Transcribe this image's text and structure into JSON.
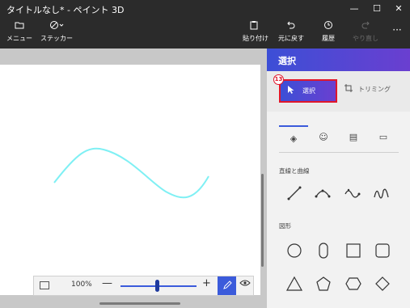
{
  "window": {
    "title": "タイトルなし* - ペイント 3D",
    "minimize": "—",
    "maximize": "☐",
    "close": "✕"
  },
  "toolbar": {
    "menu": {
      "label": "メニュー",
      "icon": "folder-icon"
    },
    "stickers": {
      "label": "ステッカー",
      "icon": "sticker-icon"
    },
    "paste": {
      "label": "貼り付け",
      "icon": "paste-icon"
    },
    "undo": {
      "label": "元に戻す",
      "icon": "undo-icon"
    },
    "history": {
      "label": "履歴",
      "icon": "history-icon"
    },
    "redo": {
      "label": "やり直し",
      "icon": "redo-icon"
    },
    "more": "···"
  },
  "zoom": {
    "value": "100%",
    "minus": "—",
    "plus": "+",
    "slider_level_percent": 45
  },
  "panel": {
    "title": "選択",
    "select_label": "選択",
    "trim_label": "トリミング",
    "badge": "13",
    "tabs": [
      {
        "name": "shapes-2d-icon",
        "glyph": "◈"
      },
      {
        "name": "sticker-palette-icon",
        "glyph": "☺"
      },
      {
        "name": "texture-icon",
        "glyph": "▤"
      },
      {
        "name": "folder-icon",
        "glyph": "▭"
      }
    ],
    "lines_section": "直線と曲線",
    "shapes_section": "図形"
  },
  "colors": {
    "accent": "#3b5bdb",
    "curve": "#7ff0f4",
    "highlight_border": "#e0162b",
    "chrome": "#2b2b2b"
  }
}
